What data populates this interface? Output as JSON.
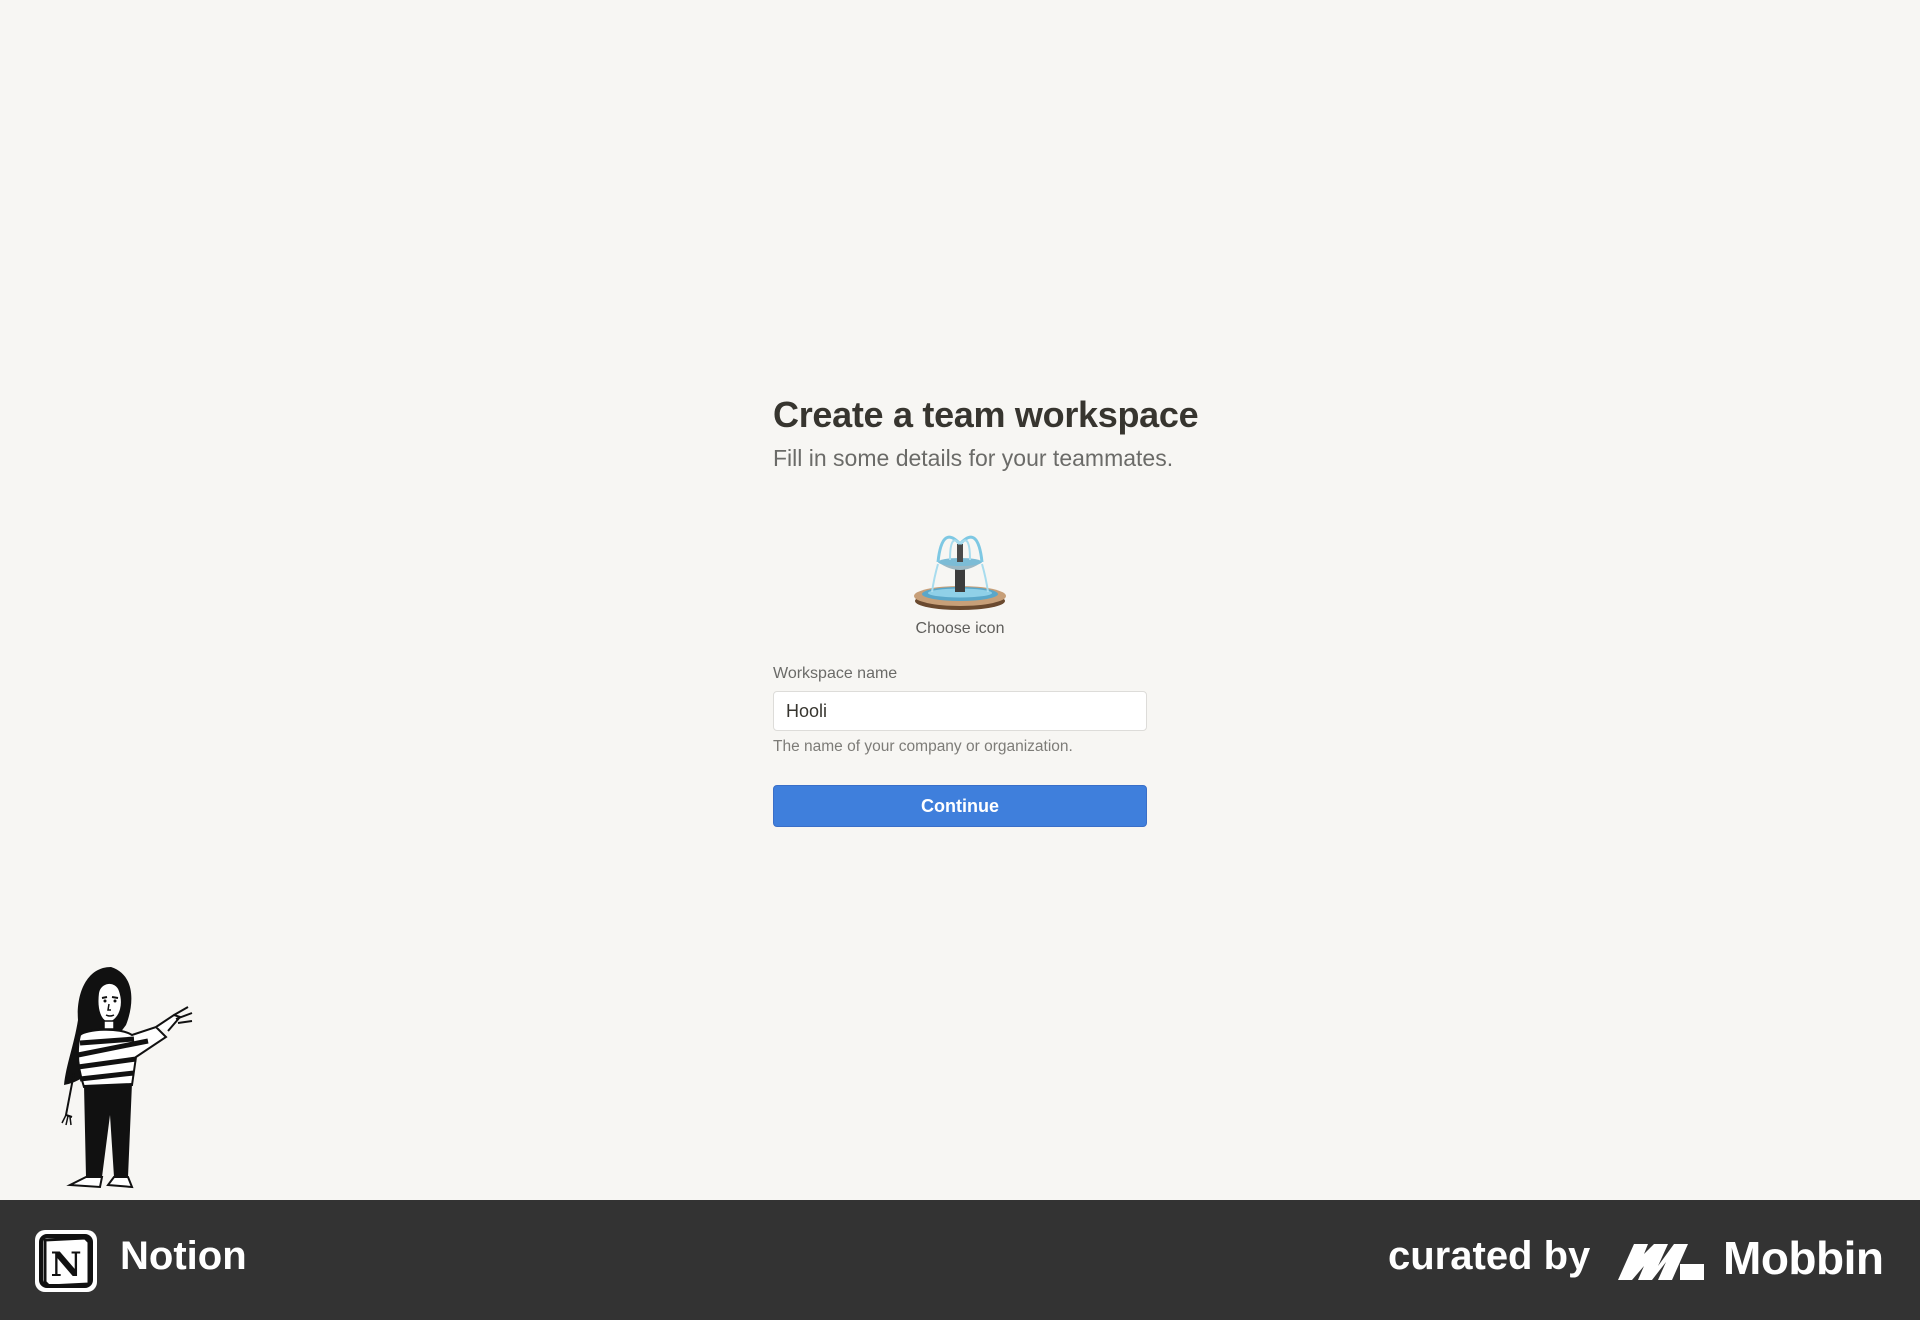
{
  "page": {
    "title": "Create a team workspace",
    "subtitle": "Fill in some details for your teammates."
  },
  "icon_picker": {
    "icon": "fountain-icon",
    "label": "Choose icon"
  },
  "workspace_name": {
    "label": "Workspace name",
    "value": "Hooli",
    "hint": "The name of your company or organization."
  },
  "continue_button": {
    "label": "Continue"
  },
  "footer": {
    "app_name": "Notion",
    "app_logo": "notion-logo-icon",
    "curated_by": "curated by",
    "brand_name": "Mobbin",
    "brand_logo": "mobbin-logo-icon"
  },
  "colors": {
    "background": "#f7f6f3",
    "primary_button": "#3f7fdc",
    "heading_text": "#37352f",
    "footer_background": "#333333"
  }
}
